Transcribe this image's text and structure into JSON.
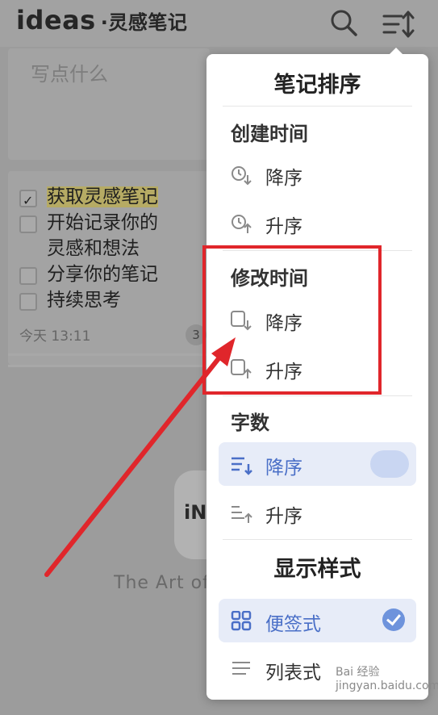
{
  "app": {
    "title": "ideas",
    "subtitle": "·灵感笔记"
  },
  "composer": {
    "placeholder": "写点什么"
  },
  "note": {
    "items": [
      {
        "text": "获取灵感笔记",
        "checked": true
      },
      {
        "text": "开始记录你的灵感和想法",
        "checked": false
      },
      {
        "text": "分享你的笔记",
        "checked": false
      },
      {
        "text": "持续思考",
        "checked": false
      }
    ],
    "time": "今天 13:11",
    "count": "3"
  },
  "brand": {
    "logo_text": "iN",
    "tagline": "The Art of C"
  },
  "sort_menu": {
    "title": "笔记排序",
    "sections": [
      {
        "label": "创建时间",
        "options": [
          "降序",
          "升序"
        ]
      },
      {
        "label": "修改时间",
        "options": [
          "降序",
          "升序"
        ]
      },
      {
        "label": "字数",
        "options": [
          "降序",
          "升序"
        ],
        "selected": 0
      }
    ],
    "style_title": "显示样式",
    "styles": [
      {
        "label": "便签式",
        "selected": true
      },
      {
        "label": "列表式",
        "selected": false
      }
    ]
  },
  "watermark": "Bai 经验 jingyan.baidu.com",
  "colors": {
    "accent": "#4a6fc7",
    "annotation": "#e0262b"
  },
  "icons": {
    "header": [
      "search-icon",
      "sort-icon"
    ],
    "create_time": "clock-icon",
    "modify_time": "edit-doc-icon",
    "word_count": "lines-sort-icon",
    "style_sticky": "grid-icon",
    "style_list": "list-icon"
  }
}
